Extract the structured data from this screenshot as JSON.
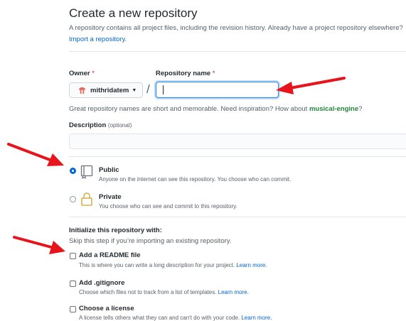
{
  "header": {
    "title": "Create a new repository",
    "subtitle": "A repository contains all project files, including the revision history. Already have a project repository elsewhere?",
    "import_link": "Import a repository."
  },
  "owner": {
    "label": "Owner",
    "required_mark": "*",
    "value": "mithridatem"
  },
  "repo_name": {
    "label": "Repository name",
    "required_mark": "*",
    "value": ""
  },
  "slash": "/",
  "hint": {
    "text": "Great repository names are short and memorable. Need inspiration? How about",
    "suggestion": "musical-engine",
    "end": "?"
  },
  "description": {
    "label": "Description",
    "optional": "(optional)",
    "value": ""
  },
  "visibility": {
    "public": {
      "title": "Public",
      "desc": "Anyone on the internet can see this repository. You choose who can commit.",
      "checked": true
    },
    "private": {
      "title": "Private",
      "desc": "You choose who can see and commit to this repository.",
      "checked": false
    }
  },
  "init": {
    "title": "Initialize this repository with:",
    "subtitle": "Skip this step if you’re importing an existing repository.",
    "readme": {
      "title": "Add a README file",
      "desc": "This is where you can write a long description for your project.",
      "link": "Learn more."
    },
    "gitignore": {
      "title": "Add .gitignore",
      "desc": "Choose which files not to track from a list of templates.",
      "link": "Learn more."
    },
    "license": {
      "title": "Choose a license",
      "desc": "A license tells others what they can and can't do with your code.",
      "link": "Learn more."
    }
  },
  "colors": {
    "annotation_arrow": "#e8141c",
    "link": "#0366d6",
    "suggestion": "#22863a",
    "focus": "#2188ff"
  },
  "icons": {
    "owner_avatar": "avatar-icon",
    "caret": "caret-down-icon",
    "public": "repo-icon",
    "private": "lock-icon"
  }
}
